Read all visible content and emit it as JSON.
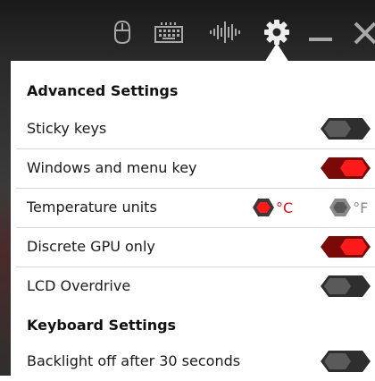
{
  "toolbar": {
    "icons": [
      "mouse-icon",
      "keyboard-icon",
      "audio-equalizer-icon",
      "gear-icon",
      "minimize-icon",
      "close-icon"
    ]
  },
  "advanced_settings": {
    "header": "Advanced Settings",
    "rows": [
      {
        "label": "Sticky keys",
        "enabled": false
      },
      {
        "label": "Windows and menu key",
        "enabled": true
      },
      {
        "label": "Temperature units",
        "options": [
          "°C",
          "°F"
        ],
        "selected": "°C"
      },
      {
        "label": "Discrete GPU only",
        "enabled": true
      },
      {
        "label": "LCD Overdrive",
        "enabled": false
      }
    ]
  },
  "keyboard_settings": {
    "header": "Keyboard Settings",
    "rows": [
      {
        "label": "Backlight off after 30 seconds",
        "enabled": false
      }
    ]
  },
  "colors": {
    "accent_red": "#e0101a",
    "toggle_off": "#2e2e2e",
    "toolbar_bg": "#1f1f1f",
    "icon_gray": "#a8a8a8"
  }
}
